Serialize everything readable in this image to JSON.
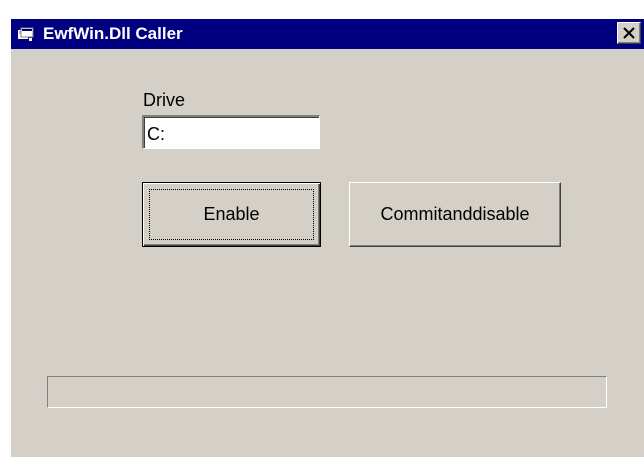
{
  "window": {
    "title": "EwfWin.Dll Caller",
    "icon": "app-icon",
    "close_icon": "close-icon",
    "titlebar_color": "#000080",
    "face_color": "#d4d0c8"
  },
  "form": {
    "drive_label": "Drive",
    "drive_value": "C:",
    "enable_label": "Enable",
    "commit_label": "Commitanddisable"
  },
  "progress": {
    "fraction": 0
  }
}
